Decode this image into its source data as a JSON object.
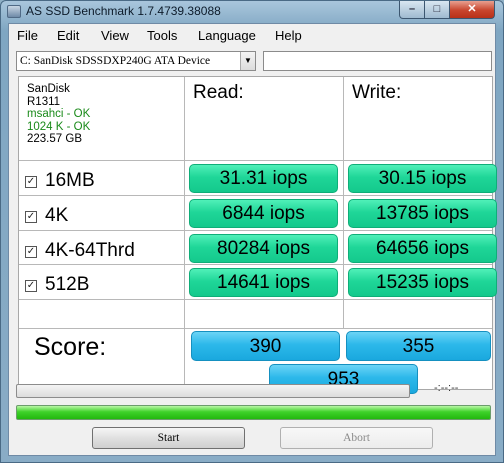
{
  "window": {
    "title": "AS SSD Benchmark 1.7.4739.38088"
  },
  "menu": [
    "File",
    "Edit",
    "View",
    "Tools",
    "Language",
    "Help"
  ],
  "device": {
    "selected": "C: SanDisk SDSSDXP240G ATA Device"
  },
  "info": {
    "vendor": "SanDisk",
    "firmware": "R1311",
    "driver": "msahci - OK",
    "alignment": "1024 K - OK",
    "size": "223.57 GB"
  },
  "headers": {
    "read": "Read:",
    "write": "Write:"
  },
  "rows": [
    {
      "label": "16MB",
      "read": "31.31 iops",
      "write": "30.15 iops"
    },
    {
      "label": "4K",
      "read": "6844 iops",
      "write": "13785 iops"
    },
    {
      "label": "4K-64Thrd",
      "read": "80284 iops",
      "write": "64656 iops"
    },
    {
      "label": "512B",
      "read": "14641 iops",
      "write": "15235 iops"
    }
  ],
  "score": {
    "label": "Score:",
    "read": "390",
    "write": "355",
    "total": "953"
  },
  "status": {
    "time": "-:--:--",
    "progress": 1.0
  },
  "buttons": {
    "start": "Start",
    "abort": "Abort"
  },
  "colors": {
    "result": "#1fd698",
    "score": "#2cb8ea",
    "ok": "#1a8a1a"
  }
}
